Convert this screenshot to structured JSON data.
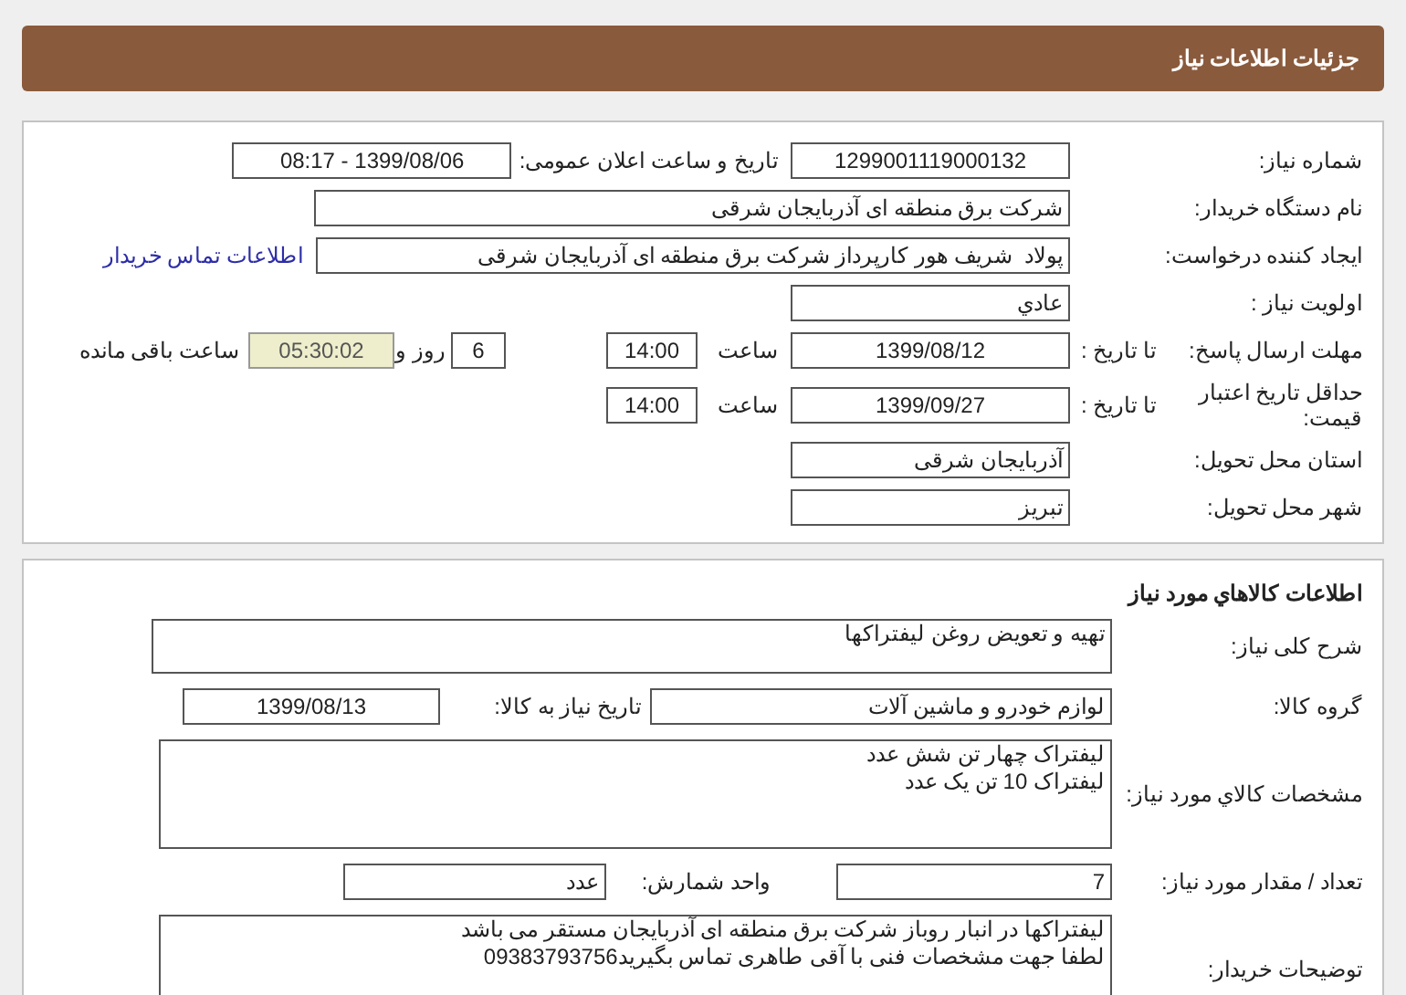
{
  "header": {
    "title": "جزئیات اطلاعات نیاز"
  },
  "need_details": {
    "rows": [
      {
        "label": "شماره نیاز:",
        "items": [
          {
            "kind": "field",
            "text": "1299001119000132"
          },
          {
            "kind": "label",
            "text": "تاریخ و ساعت اعلان عمومی:"
          },
          {
            "kind": "field",
            "text": "1399/08/06 - 08:17"
          }
        ]
      },
      {
        "label": "نام دستگاه خریدار:",
        "items": [
          {
            "kind": "field",
            "text": "شرکت برق منطقه ای آذربایجان شرقی"
          }
        ]
      },
      {
        "label": "ایجاد کننده درخواست:",
        "items": [
          {
            "kind": "field",
            "text": "پولاد  شریف هور کارپرداز شرکت برق منطقه ای آذربایجان شرقی"
          },
          {
            "kind": "link",
            "text": "اطلاعات تماس خریدار"
          }
        ]
      },
      {
        "label": "اولویت نیاز :",
        "items": [
          {
            "kind": "field",
            "text": "عادي"
          }
        ]
      },
      {
        "label": "مهلت ارسال پاسخ:",
        "sublabel": "تا تاریخ :",
        "items": [
          {
            "kind": "field",
            "text": "1399/08/12"
          },
          {
            "kind": "label",
            "text": "ساعت"
          },
          {
            "kind": "field",
            "text": "14:00"
          },
          {
            "kind": "field",
            "text": "6"
          },
          {
            "kind": "label",
            "text": "روز و"
          },
          {
            "kind": "countdown",
            "text": "05:30:02"
          },
          {
            "kind": "label",
            "text": "ساعت باقی مانده"
          }
        ]
      },
      {
        "label": "حداقل تاریخ اعتبار قیمت:",
        "sublabel": "تا تاریخ :",
        "items": [
          {
            "kind": "field",
            "text": "1399/09/27"
          },
          {
            "kind": "label",
            "text": "ساعت"
          },
          {
            "kind": "field",
            "text": "14:00"
          }
        ]
      },
      {
        "label": "استان محل تحویل:",
        "items": [
          {
            "kind": "field",
            "text": "آذربایجان شرقی"
          }
        ]
      },
      {
        "label": "شهر محل تحویل:",
        "items": [
          {
            "kind": "field",
            "text": "تبریز"
          }
        ]
      }
    ]
  },
  "goods": {
    "title": "اطلاعات کالاهاي مورد نياز",
    "rows": [
      {
        "label": "شرح کلی نیاز:",
        "items": [
          {
            "kind": "textarea",
            "lines": [
              "تهیه و تعویض روغن لیفتراکها"
            ]
          }
        ]
      },
      {
        "label": "گروه کالا:",
        "items": [
          {
            "kind": "field",
            "text": "لوازم خودرو و ماشین آلات"
          },
          {
            "kind": "label",
            "text": "تاریخ نیاز به کالا:"
          },
          {
            "kind": "field",
            "text": "1399/08/13"
          }
        ]
      },
      {
        "label": "مشخصات کالاي مورد نياز:",
        "items": [
          {
            "kind": "textarea",
            "lines": [
              "لیفتراک چهار تن شش عدد",
              "لیفتراک 10 تن یک عدد"
            ]
          }
        ]
      },
      {
        "label": "تعداد / مقدار مورد نیاز:",
        "items": [
          {
            "kind": "field",
            "text": "7"
          },
          {
            "kind": "label",
            "text": "واحد شمارش:"
          },
          {
            "kind": "field",
            "text": "عدد"
          }
        ]
      },
      {
        "label": "توضیحات خریدار:",
        "items": [
          {
            "kind": "textarea",
            "lines": [
              "لیفتراکها در انبار روباز شرکت برق منطقه ای آذربایجان مستقر می باشد",
              "لطفا جهت مشخصات فنی با آقی طاهری تماس بگیرید09383793756"
            ]
          }
        ]
      }
    ]
  }
}
